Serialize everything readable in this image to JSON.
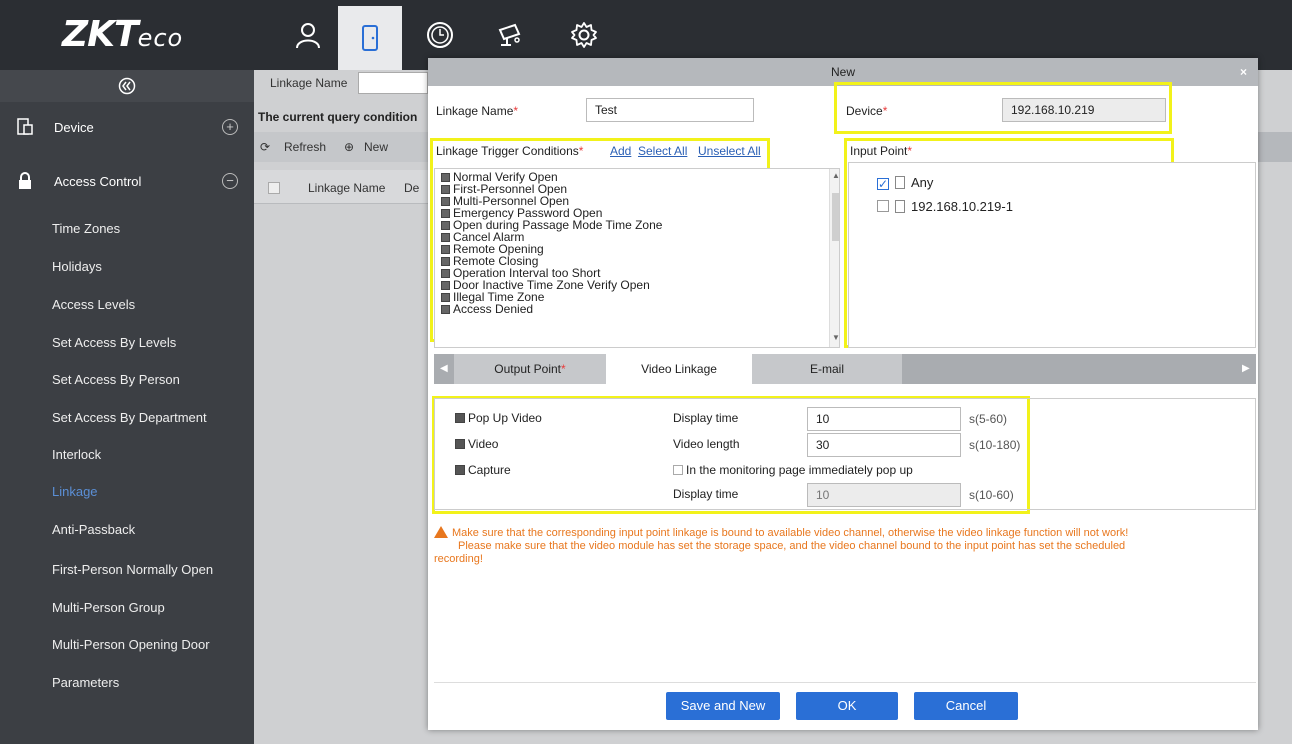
{
  "brand": {
    "logo_main": "ZKT",
    "logo_sub": "eco"
  },
  "topnav": [
    {
      "icon": "person-icon"
    },
    {
      "icon": "door-icon"
    },
    {
      "icon": "clock-icon"
    },
    {
      "icon": "camera-icon"
    },
    {
      "icon": "gear-icon"
    }
  ],
  "sidebar": {
    "sections": [
      {
        "label": "Device",
        "toggle": "+"
      },
      {
        "label": "Access Control",
        "toggle": "−"
      }
    ],
    "items": [
      "Time Zones",
      "Holidays",
      "Access Levels",
      "Set Access By Levels",
      "Set Access By Person",
      "Set Access By Department",
      "Interlock",
      "Linkage",
      "Anti-Passback",
      "First-Person Normally Open",
      "Multi-Person Group",
      "Multi-Person Opening Door",
      "Parameters"
    ],
    "active_item": "Linkage"
  },
  "background": {
    "query_label": "Linkage Name",
    "current_query": "The current query condition",
    "toolbar": {
      "refresh": "Refresh",
      "new": "New"
    },
    "columns": [
      "Linkage Name",
      "De"
    ]
  },
  "modal": {
    "title": "New",
    "close": "×",
    "linkage_name_label": "Linkage Name",
    "linkage_name_value": "Test",
    "device_label": "Device",
    "device_value": "192.168.10.219",
    "trigger_label": "Linkage Trigger Conditions",
    "add_link": "Add",
    "select_all_link": "Select All",
    "unselect_all_link": "Unselect All",
    "triggers": [
      "Normal Verify Open",
      "First-Personnel Open",
      "Multi-Personnel Open",
      "Emergency Password Open",
      "Open during Passage Mode Time Zone",
      "Cancel Alarm",
      "Remote Opening",
      "Remote Closing",
      "Operation Interval too Short",
      "Door Inactive Time Zone Verify Open",
      "Illegal Time Zone",
      "Access Denied"
    ],
    "input_point_label": "Input Point",
    "input_points": [
      {
        "label": "Any",
        "checked": true
      },
      {
        "label": "192.168.10.219-1",
        "checked": false
      }
    ],
    "tabs": [
      {
        "label": "Output Point",
        "required": true
      },
      {
        "label": "Video Linkage",
        "required": false
      },
      {
        "label": "E-mail",
        "required": false
      }
    ],
    "video": {
      "popup_label": "Pop Up Video",
      "video_label": "Video",
      "capture_label": "Capture",
      "display_time_label": "Display time",
      "display_time_value": "10",
      "display_time_range": "s(5-60)",
      "video_length_label": "Video length",
      "video_length_value": "30",
      "video_length_range": "s(10-180)",
      "monitor_popup_label": "In the monitoring page immediately pop up",
      "capture_display_label": "Display time",
      "capture_display_value": "10",
      "capture_display_range": "s(10-60)"
    },
    "warning_line1": "Make sure that the corresponding input point linkage is bound to available video channel, otherwise the video linkage function will not work!",
    "warning_line2": "Please make sure that the video module has set the storage space, and the video channel bound to the input point has set the scheduled",
    "warning_line3": "recording!",
    "buttons": {
      "save_new": "Save and New",
      "ok": "OK",
      "cancel": "Cancel"
    }
  },
  "colors": {
    "accent": "#2a6fd6",
    "highlight": "#f2f21a",
    "warning": "#e8771e",
    "topbar": "#2b2e33",
    "sidebar": "#3c3f44"
  }
}
